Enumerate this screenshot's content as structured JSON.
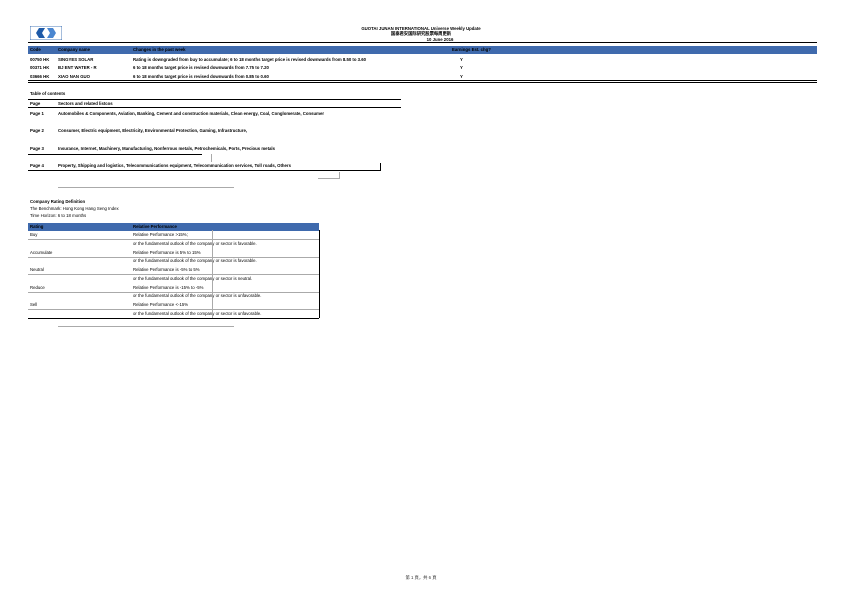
{
  "header": {
    "title_line1": "GUOTAI JUNAN INTERNATIONAL Universe Weekly Update",
    "title_line2": "国泰君安国际研究股票每周更新",
    "date": "10 June 2016"
  },
  "updates": {
    "columns": [
      "Code",
      "Company name",
      "Changes in the past week",
      "Earnings Est. chg?"
    ],
    "rows": [
      {
        "code": "00750 HK",
        "name": "SINGYES SOLAR",
        "change": "Rating is downgraded from buy to accumulate; 6 to 18 months target price is revised downwards from 8.50 to 3.60",
        "earnings": "Y"
      },
      {
        "code": "00371 HK",
        "name": "BJ ENT WATER - R",
        "change": "6 to 18 months target price is revised downwards from 7.75 to 7.20",
        "earnings": "Y"
      },
      {
        "code": "03666 HK",
        "name": "XIAO NAN GUO",
        "change": "6 to 18 months target price is revised downwards from 0.85 to 0.60",
        "earnings": "Y"
      }
    ]
  },
  "toc": {
    "title": "Table of contents",
    "columns": [
      "Page",
      "Sectors and related listcos"
    ],
    "rows": [
      {
        "page": "Page 1",
        "sectors": "Automobiles & Components, Aviation, Banking, Cement and construction materials, Clean energy, Coal, Conglomerate, Consumer"
      },
      {
        "page": "Page 2",
        "sectors": "Consumer, Electric equipment, Electricity, Environmental Protection, Gaming, Infrastructure,"
      },
      {
        "page": "Page 3",
        "sectors": "Insurance, Internet, Machinery, Manufacturing, Nonferrous metals, Petrochemicals, Ports, Precious metals"
      },
      {
        "page": "Page 4",
        "sectors": "Property, Shipping and logistics, Telecommunications equipment, Telecommunication services, Toll roads, Others"
      }
    ]
  },
  "rating_def": {
    "title": "Company Rating Definition",
    "benchmark": "The Benchmark: Hong Kong Hang Seng Index",
    "horizon": "Time Horizon: 6 to 18 months",
    "columns": [
      "Rating",
      "Relative Performance"
    ],
    "rows": [
      {
        "rating": "Buy",
        "perf": "Relative Performance >15%;"
      },
      {
        "rating": "",
        "perf": "or the fundamental outlook of the company or sector is favorable."
      },
      {
        "rating": "Accumulate",
        "perf": "Relative Performance is 5% to 15%"
      },
      {
        "rating": "",
        "perf": "or the fundamental outlook of the company or sector is favorable."
      },
      {
        "rating": "Neutral",
        "perf": "Relative Performance is -5% to 5%"
      },
      {
        "rating": "",
        "perf": "or the fundamental outlook of the company or sector is neutral."
      },
      {
        "rating": "Reduce",
        "perf": "Relative Performance is -15% to -5%"
      },
      {
        "rating": "",
        "perf": "or the fundamental outlook of the company or sector is unfavorable."
      },
      {
        "rating": "Sell",
        "perf": "Relative Performance <-15%"
      },
      {
        "rating": "",
        "perf": "or the fundamental outlook of the company or sector is unfavorable."
      }
    ]
  },
  "footer": {
    "page_indicator": "第 1 頁，共 6 頁"
  },
  "colors": {
    "header_blue": "#3f6aad",
    "logo_blue": "#1e5aa8"
  },
  "icons": {
    "logo": "gtja-logo"
  }
}
